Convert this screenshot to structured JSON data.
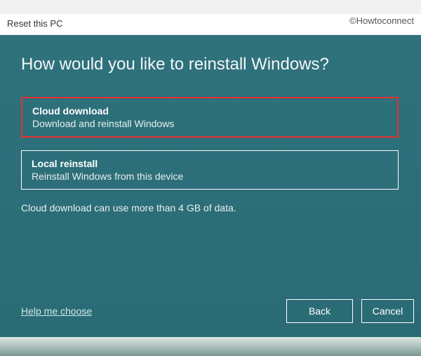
{
  "watermark": "©Howtoconnect",
  "window_title": "Reset this PC",
  "heading": "How would you like to reinstall Windows?",
  "options": [
    {
      "title": "Cloud download",
      "description": "Download and reinstall Windows"
    },
    {
      "title": "Local reinstall",
      "description": "Reinstall Windows from this device"
    }
  ],
  "info_text": "Cloud download can use more than 4 GB of data.",
  "help_link": "Help me choose",
  "buttons": {
    "back": "Back",
    "cancel": "Cancel"
  }
}
